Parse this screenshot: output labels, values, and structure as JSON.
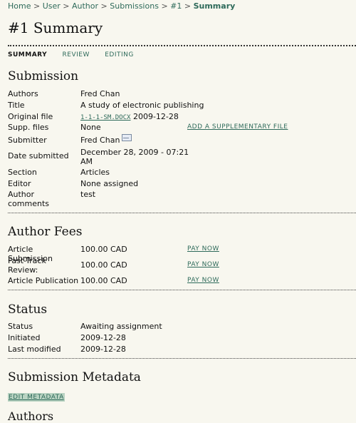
{
  "breadcrumb": {
    "items": [
      "Home",
      "User",
      "Author",
      "Submissions",
      "#1"
    ],
    "separator": ">",
    "current": "Summary"
  },
  "page_title": "#1 Summary",
  "tabs": [
    {
      "label": "SUMMARY",
      "active": true
    },
    {
      "label": "REVIEW",
      "active": false
    },
    {
      "label": "EDITING",
      "active": false
    }
  ],
  "submission": {
    "heading": "Submission",
    "authors_label": "Authors",
    "authors_value": "Fred Chan",
    "title_label": "Title",
    "title_value": "A study of electronic publishing",
    "original_file_label": "Original file",
    "original_file_link": "1-1-1-SM.DOCX",
    "original_file_date": "2009-12-28",
    "supp_label": "Supp. files",
    "supp_value": "None",
    "supp_action": "ADD A SUPPLEMENTARY FILE",
    "submitter_label": "Submitter",
    "submitter_value": "Fred Chan",
    "date_label": "Date submitted",
    "date_value_line1": "December 28, 2009 - 07:21",
    "date_value_line2": "AM",
    "section_label": "Section",
    "section_value": "Articles",
    "editor_label": "Editor",
    "editor_value": "None assigned",
    "author_comments_label_line1": "Author",
    "author_comments_label_line2": "comments",
    "author_comments_value": "test"
  },
  "author_fees": {
    "heading": "Author Fees",
    "rows": [
      {
        "label": "Article Submission",
        "amount": "100.00 CAD",
        "action": "PAY NOW"
      },
      {
        "label": "Fast-Track Review:",
        "amount": "100.00 CAD",
        "action": "PAY NOW"
      },
      {
        "label": "Article Publication",
        "amount": "100.00 CAD",
        "action": "PAY NOW"
      }
    ],
    "fast_track_line1": "Fast-Track",
    "fast_track_line2": "Review:"
  },
  "status": {
    "heading": "Status",
    "status_label": "Status",
    "status_value": "Awaiting assignment",
    "initiated_label": "Initiated",
    "initiated_value": "2009-12-28",
    "modified_label": "Last modified",
    "modified_value": "2009-12-28"
  },
  "metadata": {
    "heading": "Submission Metadata",
    "edit_label": "EDIT METADATA",
    "authors_heading": "Authors"
  },
  "colors": {
    "background": "#f8f7ef",
    "link": "#2e6a5a",
    "highlight": "#b9d3c2"
  }
}
